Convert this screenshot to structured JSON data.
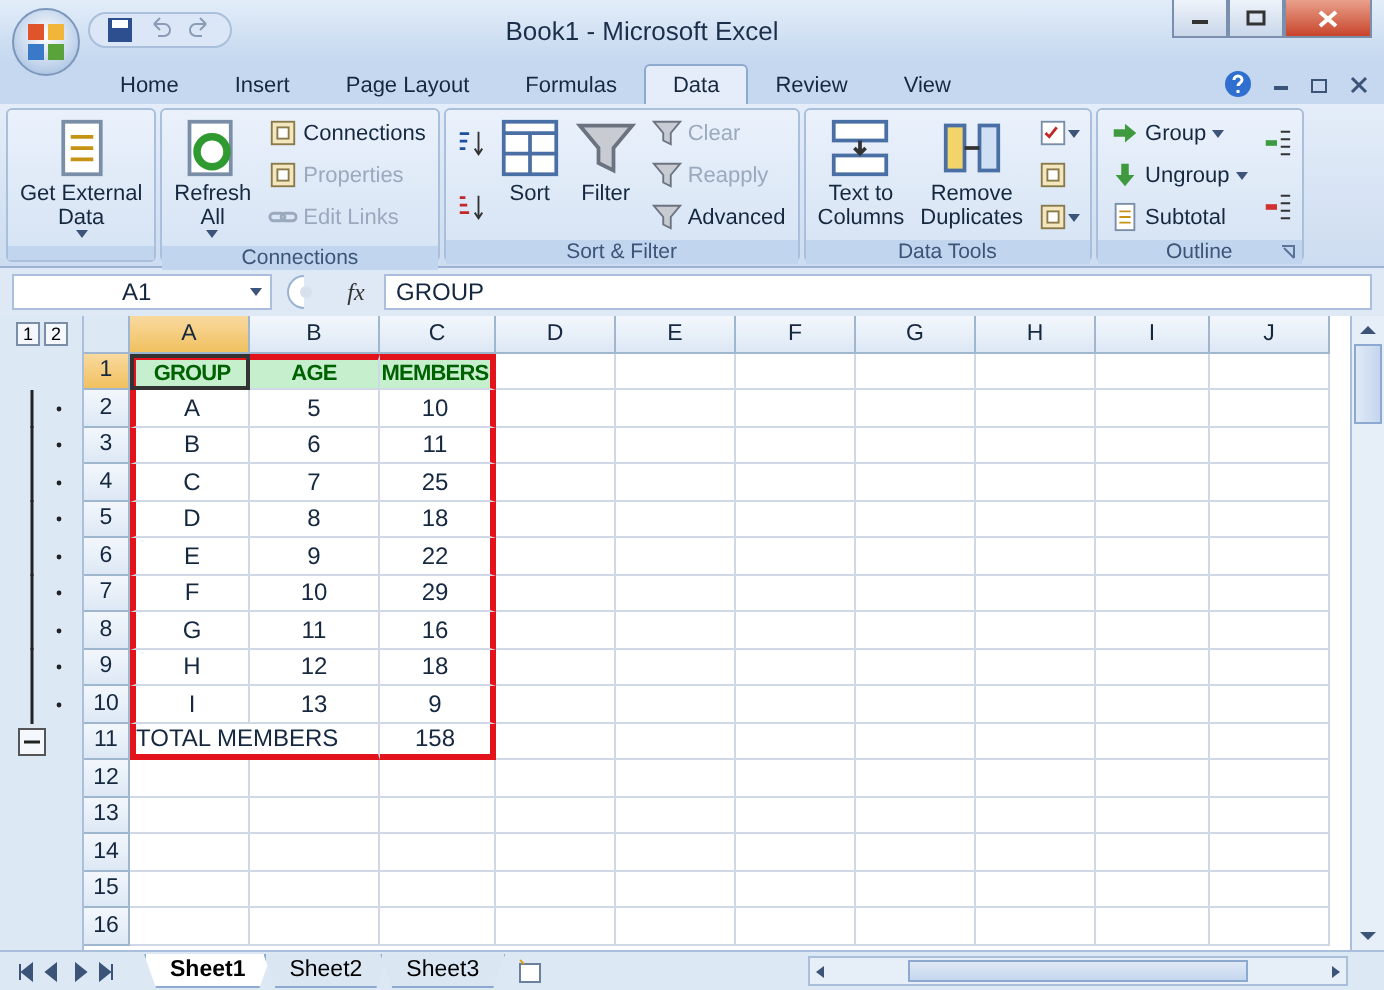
{
  "window": {
    "title": "Book1 - Microsoft Excel"
  },
  "tabs": [
    {
      "label": "Home",
      "selected": false
    },
    {
      "label": "Insert",
      "selected": false
    },
    {
      "label": "Page Layout",
      "selected": false
    },
    {
      "label": "Formulas",
      "selected": false
    },
    {
      "label": "Data",
      "selected": true
    },
    {
      "label": "Review",
      "selected": false
    },
    {
      "label": "View",
      "selected": false
    }
  ],
  "ribbon": [
    {
      "columns": [
        [
          {
            "kind": "large",
            "label": "Get External\nData",
            "dropdown": true,
            "disabled": false
          }
        ]
      ]
    },
    {
      "label": "Connections",
      "columns": [
        [
          {
            "kind": "large",
            "label": "Refresh\nAll",
            "dropdown": true,
            "disabled": false
          }
        ],
        [
          {
            "kind": "small",
            "label": "Connections",
            "dropdown": false,
            "disabled": false
          },
          {
            "kind": "small",
            "label": "Properties",
            "dropdown": false,
            "disabled": true
          },
          {
            "kind": "small",
            "label": "Edit Links",
            "dropdown": false,
            "disabled": true
          }
        ]
      ]
    },
    {
      "label": "Sort & Filter",
      "columns": [
        [
          {
            "kind": "icon",
            "dropdown": false,
            "disabled": false
          },
          {
            "kind": "icon",
            "dropdown": false,
            "disabled": false
          }
        ],
        [
          {
            "kind": "large",
            "label": "Sort",
            "dropdown": false,
            "disabled": false
          }
        ],
        [
          {
            "kind": "large",
            "label": "Filter",
            "dropdown": false,
            "disabled": false
          }
        ],
        [
          {
            "kind": "small",
            "label": "Clear",
            "dropdown": false,
            "disabled": true
          },
          {
            "kind": "small",
            "label": "Reapply",
            "dropdown": false,
            "disabled": true
          },
          {
            "kind": "small",
            "label": "Advanced",
            "dropdown": false,
            "disabled": false
          }
        ]
      ]
    },
    {
      "label": "Data Tools",
      "columns": [
        [
          {
            "kind": "large",
            "label": "Text to\nColumns",
            "dropdown": false,
            "disabled": false
          }
        ],
        [
          {
            "kind": "large",
            "label": "Remove\nDuplicates",
            "dropdown": false,
            "disabled": false
          }
        ],
        [
          {
            "kind": "icon",
            "dropdown": true,
            "disabled": false
          },
          {
            "kind": "icon",
            "dropdown": false,
            "disabled": false
          },
          {
            "kind": "icon",
            "dropdown": true,
            "disabled": false
          }
        ]
      ]
    },
    {
      "label": "Outline",
      "columns": [
        [
          {
            "kind": "small",
            "label": "Group",
            "dropdown": true,
            "disabled": false
          },
          {
            "kind": "small",
            "label": "Ungroup",
            "dropdown": true,
            "disabled": false
          },
          {
            "kind": "small",
            "label": "Subtotal",
            "dropdown": false,
            "disabled": false
          }
        ],
        [
          {
            "kind": "icon",
            "dropdown": false,
            "disabled": false
          },
          {
            "kind": "icon",
            "dropdown": false,
            "disabled": false
          }
        ]
      ]
    }
  ],
  "name_box": "A1",
  "fx": "fx",
  "formula": "GROUP",
  "outline_levels": [
    "1",
    "2"
  ],
  "columns": [
    {
      "label": "A",
      "selected": true
    },
    {
      "label": "B",
      "selected": false
    },
    {
      "label": "C",
      "selected": false
    },
    {
      "label": "D",
      "selected": false
    },
    {
      "label": "E",
      "selected": false
    },
    {
      "label": "F",
      "selected": false
    },
    {
      "label": "G",
      "selected": false
    },
    {
      "label": "H",
      "selected": false
    },
    {
      "label": "I",
      "selected": false
    },
    {
      "label": "J",
      "selected": false
    }
  ],
  "rows": [
    {
      "number": "1",
      "selected": true,
      "grouped": false,
      "boxed": true,
      "kind": "header",
      "cells": [
        {
          "text": "GROUP",
          "selected": true
        },
        {
          "text": "AGE",
          "selected": false
        },
        {
          "text": "MEMBERS",
          "selected": false
        }
      ]
    },
    {
      "number": "2",
      "selected": false,
      "grouped": true,
      "boxed": true,
      "kind": "data",
      "cells": [
        {
          "text": "A",
          "selected": false
        },
        {
          "text": "5",
          "selected": false
        },
        {
          "text": "10",
          "selected": false
        }
      ]
    },
    {
      "number": "3",
      "selected": false,
      "grouped": true,
      "boxed": true,
      "kind": "data",
      "cells": [
        {
          "text": "B",
          "selected": false
        },
        {
          "text": "6",
          "selected": false
        },
        {
          "text": "11",
          "selected": false
        }
      ]
    },
    {
      "number": "4",
      "selected": false,
      "grouped": true,
      "boxed": true,
      "kind": "data",
      "cells": [
        {
          "text": "C",
          "selected": false
        },
        {
          "text": "7",
          "selected": false
        },
        {
          "text": "25",
          "selected": false
        }
      ]
    },
    {
      "number": "5",
      "selected": false,
      "grouped": true,
      "boxed": true,
      "kind": "data",
      "cells": [
        {
          "text": "D",
          "selected": false
        },
        {
          "text": "8",
          "selected": false
        },
        {
          "text": "18",
          "selected": false
        }
      ]
    },
    {
      "number": "6",
      "selected": false,
      "grouped": true,
      "boxed": true,
      "kind": "data",
      "cells": [
        {
          "text": "E",
          "selected": false
        },
        {
          "text": "9",
          "selected": false
        },
        {
          "text": "22",
          "selected": false
        }
      ]
    },
    {
      "number": "7",
      "selected": false,
      "grouped": true,
      "boxed": true,
      "kind": "data",
      "cells": [
        {
          "text": "F",
          "selected": false
        },
        {
          "text": "10",
          "selected": false
        },
        {
          "text": "29",
          "selected": false
        }
      ]
    },
    {
      "number": "8",
      "selected": false,
      "grouped": true,
      "boxed": true,
      "kind": "data",
      "cells": [
        {
          "text": "G",
          "selected": false
        },
        {
          "text": "11",
          "selected": false
        },
        {
          "text": "16",
          "selected": false
        }
      ]
    },
    {
      "number": "9",
      "selected": false,
      "grouped": true,
      "boxed": true,
      "kind": "data",
      "cells": [
        {
          "text": "H",
          "selected": false
        },
        {
          "text": "12",
          "selected": false
        },
        {
          "text": "18",
          "selected": false
        }
      ]
    },
    {
      "number": "10",
      "selected": false,
      "grouped": true,
      "boxed": true,
      "kind": "data",
      "cells": [
        {
          "text": "I",
          "selected": false
        },
        {
          "text": "13",
          "selected": false
        },
        {
          "text": "9",
          "selected": false
        }
      ]
    },
    {
      "number": "11",
      "selected": false,
      "grouped": false,
      "boxed": true,
      "kind": "data",
      "cells": [
        {
          "text": "TOTAL MEMBERS",
          "kind": "wide",
          "selected": false
        },
        {
          "text": "158",
          "kind": "plain",
          "selected": false
        }
      ]
    },
    {
      "number": "12",
      "selected": false
    },
    {
      "number": "13",
      "selected": false
    },
    {
      "number": "14",
      "selected": false
    },
    {
      "number": "15",
      "selected": false
    },
    {
      "number": "16",
      "selected": false
    }
  ],
  "sheets": [
    {
      "label": "Sheet1",
      "selected": true
    },
    {
      "label": "Sheet2",
      "selected": false
    },
    {
      "label": "Sheet3",
      "selected": false
    }
  ]
}
